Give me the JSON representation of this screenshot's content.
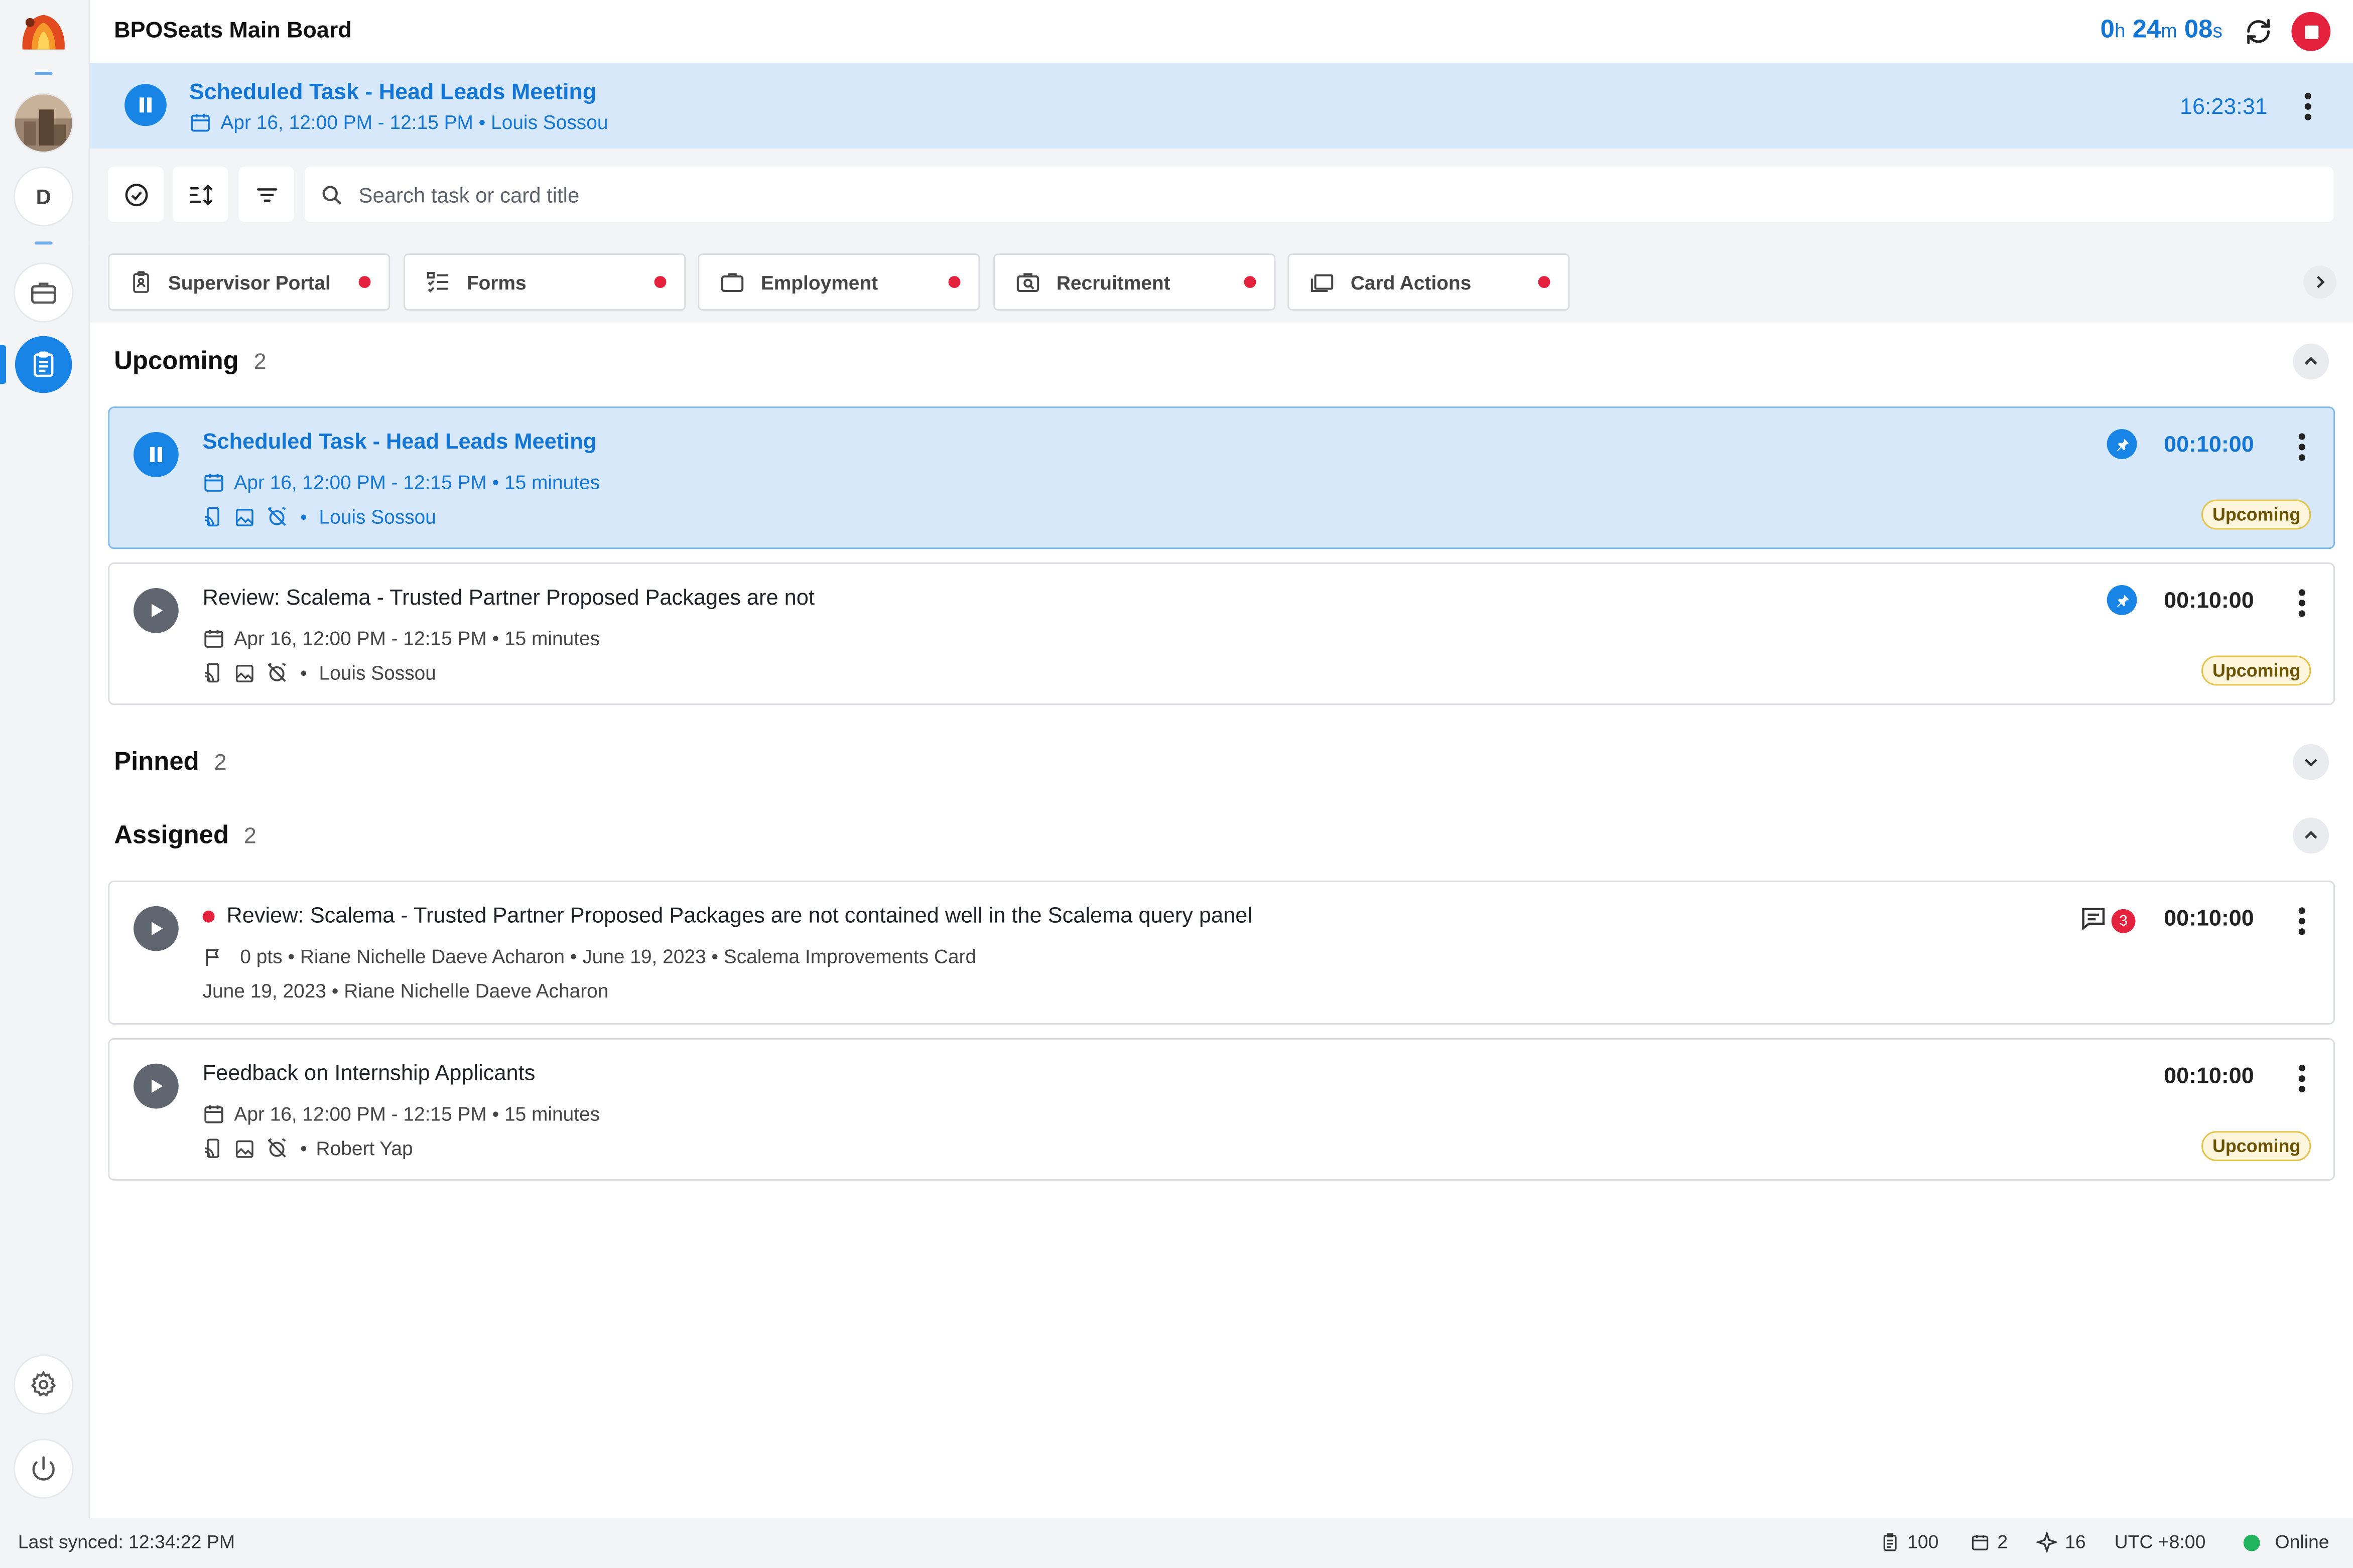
{
  "app": {
    "title": "BPOSeats Main Board"
  },
  "timer": {
    "h": "0",
    "h_unit": "h",
    "m": "24",
    "m_unit": "m",
    "s": "08",
    "s_unit": "s"
  },
  "sidebar": {
    "avatar_letter": "D"
  },
  "banner": {
    "title": "Scheduled Task - Head Leads Meeting",
    "subtitle": "Apr 16, 12:00 PM - 12:15 PM • Louis Sossou",
    "time": "16:23:31"
  },
  "search": {
    "placeholder": "Search task or card title"
  },
  "tabs": [
    {
      "label": "Supervisor Portal",
      "icon": "clipboard-user-icon"
    },
    {
      "label": "Forms",
      "icon": "checklist-icon"
    },
    {
      "label": "Employment",
      "icon": "briefcase-icon"
    },
    {
      "label": "Recruitment",
      "icon": "search-case-icon"
    },
    {
      "label": "Card Actions",
      "icon": "cards-icon"
    }
  ],
  "sections": {
    "upcoming": {
      "label": "Upcoming",
      "count": "2"
    },
    "pinned": {
      "label": "Pinned",
      "count": "2"
    },
    "assigned": {
      "label": "Assigned",
      "count": "2"
    }
  },
  "upcoming_cards": [
    {
      "title": "Scheduled Task - Head Leads Meeting",
      "schedule": "Apr 16, 12:00 PM - 12:15 PM • 15 minutes",
      "person": "Louis Sossou",
      "time": "00:10:00",
      "badge": "Upcoming"
    },
    {
      "title": "Review: Scalema - Trusted Partner Proposed Packages are not",
      "schedule": "Apr 16, 12:00 PM - 12:15 PM • 15 minutes",
      "person": "Louis Sossou",
      "time": "00:10:00",
      "badge": "Upcoming"
    }
  ],
  "assigned_cards": [
    {
      "title": "Review: Scalema - Trusted Partner Proposed Packages are not contained well in the Scalema query panel",
      "meta1": "0 pts • Riane Nichelle Daeve Acharon • June 19, 2023 • Scalema Improvements Card",
      "meta2": "June 19, 2023 • Riane Nichelle Daeve Acharon",
      "comments": "3",
      "time": "00:10:00"
    },
    {
      "title": "Feedback on Internship Applicants",
      "schedule": "Apr 16, 12:00 PM - 12:15 PM • 15 minutes",
      "person": "Robert Yap",
      "time": "00:10:00",
      "badge": "Upcoming"
    }
  ],
  "footer": {
    "last_synced": "Last synced: 12:34:22 PM",
    "tasks": "100",
    "calendar": "2",
    "sparkle": "16",
    "timezone": "UTC +8:00",
    "status": "Online"
  },
  "colors": {
    "accent": "#1784e6",
    "banner_bg": "#d6e8f9",
    "alert": "#e5223d",
    "online": "#22b35e"
  }
}
